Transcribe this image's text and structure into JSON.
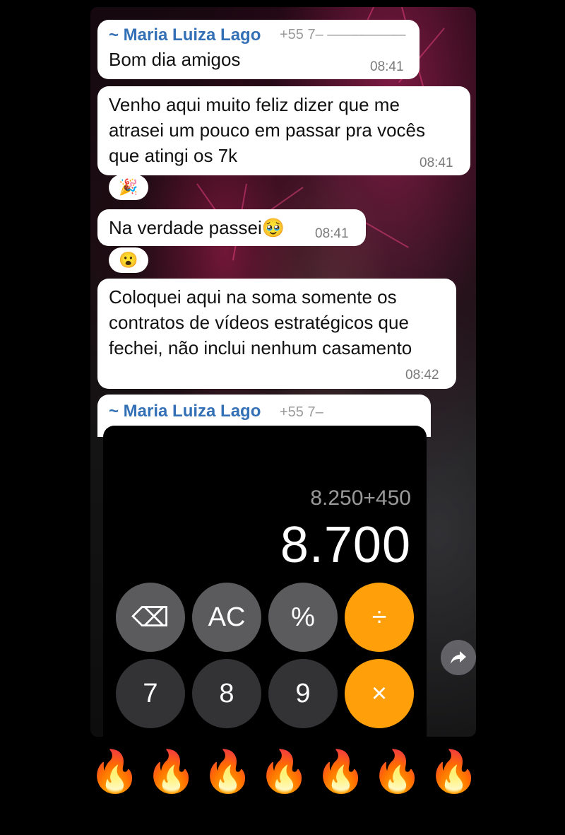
{
  "messages": [
    {
      "sender": "~ Maria Luiza Lago",
      "phone": "+55 7– ––––––––––",
      "text": "Bom dia amigos",
      "time": "08:41"
    },
    {
      "lines": [
        "Venho aqui muito feliz dizer que me",
        "atrasei um pouco em passar pra vocês",
        "que atingi os 7k"
      ],
      "time": "08:41",
      "reaction": "🎉"
    },
    {
      "text": "Na verdade passei🥹",
      "time": "08:41",
      "reaction": "😮"
    },
    {
      "lines": [
        "Coloquei aqui na soma somente os",
        "contratos de vídeos estratégicos que",
        "fechei, não inclui nenhum casamento"
      ],
      "time": "08:42"
    }
  ],
  "image_message": {
    "sender": "~ Maria Luiza Lago",
    "phone": "+55 7–"
  },
  "calculator": {
    "expression": "8.250+450",
    "result": "8.700",
    "keys": {
      "backspace": "⌫",
      "ac": "AC",
      "percent": "%",
      "divide": "÷",
      "seven": "7",
      "eight": "8",
      "nine": "9",
      "multiply": "×"
    }
  },
  "forward_icon": "share-forward-icon",
  "footer_emojis": [
    "🔥",
    "🔥",
    "🔥",
    "🔥",
    "🔥",
    "🔥",
    "🔥"
  ],
  "colors": {
    "sender": "#3470b6",
    "calc_orange": "#ff9f0a",
    "calc_gray": "#5b5b5d",
    "calc_dark": "#333335"
  }
}
